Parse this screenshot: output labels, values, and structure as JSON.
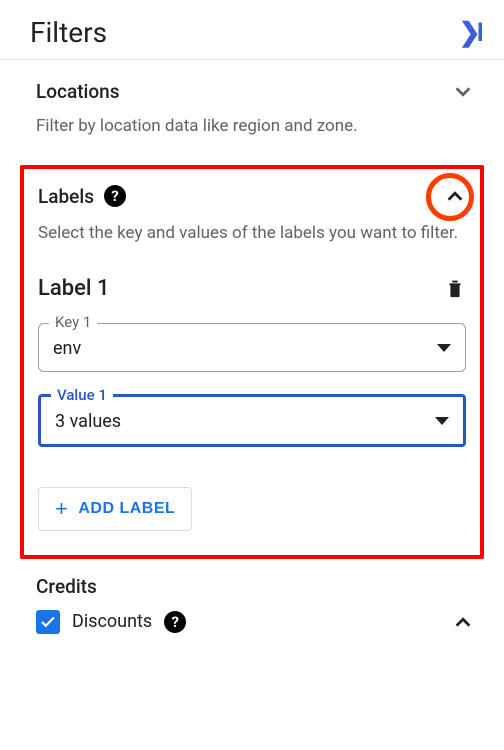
{
  "header": {
    "title": "Filters"
  },
  "locations": {
    "title": "Locations",
    "subtitle": "Filter by location data like region and zone."
  },
  "labels": {
    "title": "Labels",
    "subtitle": "Select the key and values of the labels you want to filter.",
    "label1": {
      "title": "Label 1",
      "keyLabel": "Key 1",
      "keyValue": "env",
      "valueLabel": "Value 1",
      "valueText": "3 values"
    },
    "addButton": "ADD LABEL"
  },
  "credits": {
    "title": "Credits",
    "discounts": "Discounts"
  }
}
